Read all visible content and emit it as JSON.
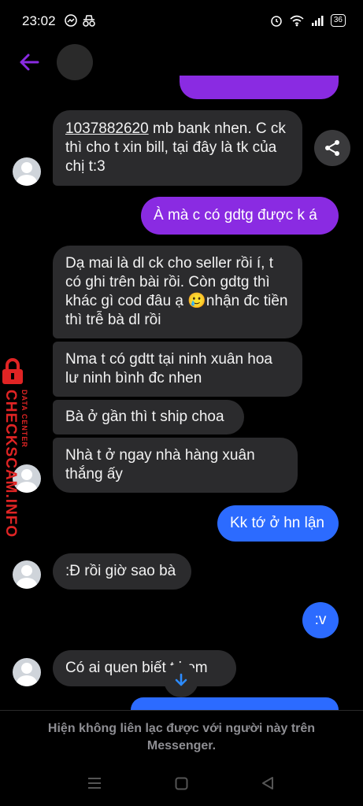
{
  "status_bar": {
    "time": "23:02",
    "battery": "36"
  },
  "messages": [
    {
      "id": "m1",
      "phone": "1037882620",
      "text": " mb bank nhen. C ck thì cho t xin bill, tại đây là tk của chị t:3"
    },
    {
      "id": "m2",
      "text": "À mà c có gdtg được k á"
    },
    {
      "id": "m3",
      "text": "Dạ mai là dl ck cho seller rồi í, t có ghi trên bài rồi. Còn gdtg thì khác gì cod đâu ạ 🥲nhận đc tiền thì trễ bà dl rồi"
    },
    {
      "id": "m4",
      "text": "Nma t có gdtt tại ninh xuân hoa lư ninh bình đc nhen"
    },
    {
      "id": "m5",
      "text": "Bà ở gần thì t ship choa"
    },
    {
      "id": "m6",
      "text": "Nhà t ở ngay nhà hàng xuân thắng ấy"
    },
    {
      "id": "m7",
      "text": "Kk tớ ở hn lận"
    },
    {
      "id": "m8",
      "text": ":Đ rồi giờ sao bà"
    },
    {
      "id": "m9",
      "text": ":v"
    },
    {
      "id": "m10",
      "text": "Có ai quen biết t hem"
    }
  ],
  "footer": {
    "notice": "Hiện không liên lạc được với người này trên Messenger."
  },
  "watermark": {
    "brand": "CHECKSCAM.INFO",
    "sub": "DATA CENTER"
  },
  "colors": {
    "accent": "#8a2be2",
    "out_blue": "#2c6bff",
    "in_bubble": "#2b2b2d"
  }
}
